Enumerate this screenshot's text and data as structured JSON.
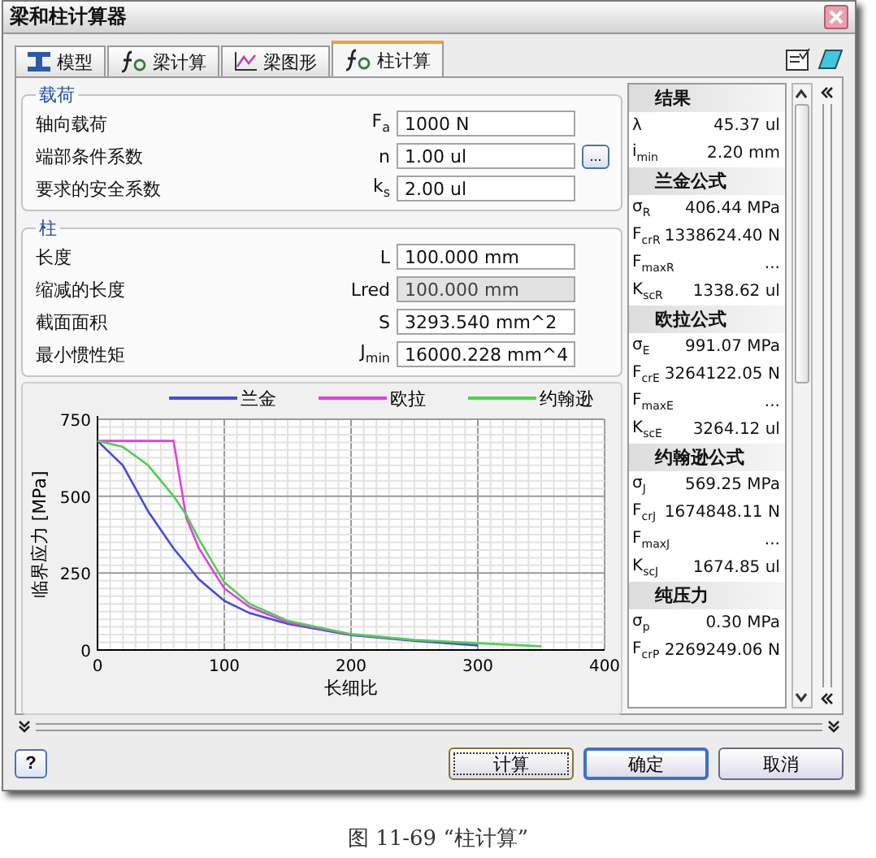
{
  "window": {
    "title": "梁和柱计算器"
  },
  "tabs": [
    {
      "label": "模型",
      "kind": "model",
      "selected": false
    },
    {
      "label": "梁计算",
      "kind": "formula",
      "selected": false
    },
    {
      "label": "梁图形",
      "kind": "graph",
      "selected": false
    },
    {
      "label": "柱计算",
      "kind": "formula",
      "selected": true
    }
  ],
  "groups": [
    {
      "title": "载荷",
      "rows": [
        {
          "label": "轴向载荷",
          "symbol": "F$_{a}$",
          "value": "1000 N",
          "disabled": false
        },
        {
          "label": "端部条件系数",
          "symbol": "n",
          "value": "1.00 ul",
          "disabled": false,
          "button": "..."
        },
        {
          "label": "要求的安全系数",
          "symbol": "k$_{s}$",
          "value": "2.00 ul",
          "disabled": false
        }
      ]
    },
    {
      "title": "柱",
      "rows": [
        {
          "label": "长度",
          "symbol": "L",
          "value": "100.000 mm",
          "disabled": false
        },
        {
          "label": "缩减的长度",
          "symbol": "Lred",
          "value": "100.000 mm",
          "disabled": true
        },
        {
          "label": "截面面积",
          "symbol": "S",
          "value": "3293.540 mm^2",
          "disabled": false
        },
        {
          "label": "最小惯性矩",
          "symbol": "J$_{min}$",
          "value": "16000.228 mm^4",
          "disabled": false
        }
      ]
    }
  ],
  "chart": {
    "chart_data": {
      "type": "line",
      "xlabel": "长细比",
      "ylabel": "临界应力 [MPa]",
      "x": [
        0,
        20,
        40,
        60,
        70,
        80,
        100,
        120,
        150,
        200,
        250,
        300,
        350
      ],
      "series": [
        {
          "name": "兰金",
          "color": "#4a4ad8",
          "values": [
            680,
            600,
            450,
            330,
            280,
            230,
            160,
            120,
            85,
            48,
            30,
            15,
            null
          ]
        },
        {
          "name": "欧拉",
          "color": "#e040e0",
          "values": [
            680,
            680,
            680,
            680,
            430,
            330,
            200,
            140,
            90,
            50,
            32,
            null,
            null
          ]
        },
        {
          "name": "约翰逊",
          "color": "#50d050",
          "values": [
            680,
            660,
            600,
            500,
            440,
            360,
            220,
            150,
            95,
            52,
            33,
            22,
            12
          ]
        }
      ],
      "grid": true,
      "legend": "top",
      "xlim": [
        0,
        400
      ],
      "ylim": [
        0,
        750
      ],
      "xticks": [
        0,
        100,
        200,
        300,
        400
      ],
      "yticks": [
        0,
        250,
        500,
        750
      ]
    }
  },
  "results": [
    {
      "title": "结果",
      "rows": [
        {
          "symbol": "λ",
          "value": "45.37 ul"
        },
        {
          "symbol": "i$_{min}$",
          "value": "2.20 mm"
        }
      ]
    },
    {
      "title": "兰金公式",
      "rows": [
        {
          "symbol": "σ$_{R}$",
          "value": "406.44 MPa"
        },
        {
          "symbol": "F$_{crR}$",
          "value": "1338624.40 N"
        },
        {
          "symbol": "F$_{maxR}$",
          "value": "..."
        },
        {
          "symbol": "K$_{scR}$",
          "value": "1338.62 ul"
        }
      ]
    },
    {
      "title": "欧拉公式",
      "rows": [
        {
          "symbol": "σ$_{E}$",
          "value": "991.07 MPa"
        },
        {
          "symbol": "F$_{crE}$",
          "value": "3264122.05 N"
        },
        {
          "symbol": "F$_{maxE}$",
          "value": "..."
        },
        {
          "symbol": "K$_{scE}$",
          "value": "3264.12 ul"
        }
      ]
    },
    {
      "title": "约翰逊公式",
      "rows": [
        {
          "symbol": "σ$_{J}$",
          "value": "569.25 MPa"
        },
        {
          "symbol": "F$_{crJ}$",
          "value": "1674848.11 N"
        },
        {
          "symbol": "F$_{maxJ}$",
          "value": "..."
        },
        {
          "symbol": "K$_{scJ}$",
          "value": "1674.85 ul"
        }
      ]
    },
    {
      "title": "纯压力",
      "rows": [
        {
          "symbol": "σ$_{p}$",
          "value": "0.30 MPa"
        },
        {
          "symbol": "F$_{crP}$",
          "value": "2269249.06 N"
        }
      ]
    }
  ],
  "help": "?",
  "buttons": [
    {
      "label": "计算",
      "kind": "focused"
    },
    {
      "label": "确定",
      "kind": "default"
    },
    {
      "label": "取消",
      "kind": "normal"
    }
  ],
  "caption": "图 11-69 “柱计算”"
}
